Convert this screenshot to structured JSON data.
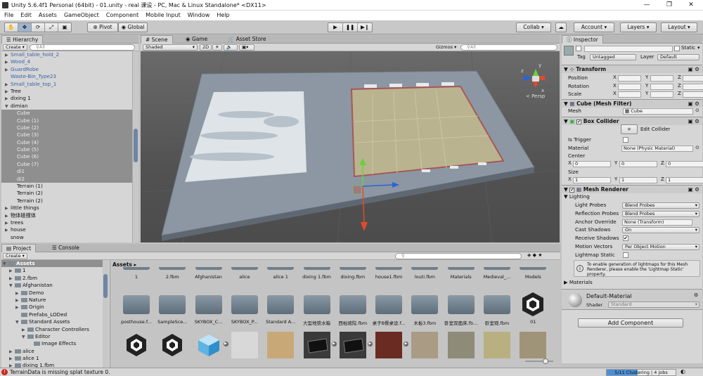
{
  "window": {
    "title": "Unity 5.6.4f1 Personal (64bit) - 01.unity - real 课设 - PC, Mac & Linux Standalone* <DX11>"
  },
  "menu": [
    "File",
    "Edit",
    "Assets",
    "GameObject",
    "Component",
    "Mobile Input",
    "Window",
    "Help"
  ],
  "toolbar": {
    "pivot": "Pivot",
    "global": "Global",
    "collab": "Collab ▾",
    "account": "Account",
    "layers": "Layers",
    "layout": "Layout"
  },
  "hierarchy": {
    "tab": "Hierarchy",
    "create": "Create ▾",
    "search": "All",
    "items": [
      {
        "label": "Small_table_hold_2",
        "indent": 1,
        "arrow": "▶",
        "style": "prefab"
      },
      {
        "label": "Wood_4",
        "indent": 1,
        "arrow": "▶",
        "style": "prefab"
      },
      {
        "label": "GuardRobe",
        "indent": 1,
        "arrow": "▶",
        "style": "prefab"
      },
      {
        "label": "Waste-Bin_Type23",
        "indent": 1,
        "arrow": "",
        "style": "prefab"
      },
      {
        "label": "Small_table_top_1",
        "indent": 1,
        "arrow": "▶",
        "style": "prefab"
      },
      {
        "label": "Tree",
        "indent": 1,
        "arrow": "▶",
        "style": "normal"
      },
      {
        "label": "dixing 1",
        "indent": 1,
        "arrow": "▶",
        "style": "normal"
      },
      {
        "label": "dimian",
        "indent": 1,
        "arrow": "▼",
        "style": "normal"
      },
      {
        "label": "Cube",
        "indent": 2,
        "arrow": "",
        "style": "selected"
      },
      {
        "label": "Cube (1)",
        "indent": 2,
        "arrow": "",
        "style": "selected"
      },
      {
        "label": "Cube (2)",
        "indent": 2,
        "arrow": "",
        "style": "selected"
      },
      {
        "label": "Cube (3)",
        "indent": 2,
        "arrow": "",
        "style": "selected"
      },
      {
        "label": "Cube (4)",
        "indent": 2,
        "arrow": "",
        "style": "selected"
      },
      {
        "label": "Cube (5)",
        "indent": 2,
        "arrow": "",
        "style": "selected"
      },
      {
        "label": "Cube (6)",
        "indent": 2,
        "arrow": "",
        "style": "selected"
      },
      {
        "label": "Cube (7)",
        "indent": 2,
        "arrow": "",
        "style": "selected"
      },
      {
        "label": "di1",
        "indent": 2,
        "arrow": "",
        "style": "selected"
      },
      {
        "label": "di2",
        "indent": 2,
        "arrow": "",
        "style": "selected"
      },
      {
        "label": "Terrain (1)",
        "indent": 2,
        "arrow": "",
        "style": "normal"
      },
      {
        "label": "Terrain (2)",
        "indent": 2,
        "arrow": "",
        "style": "normal"
      },
      {
        "label": "Terrain (2)",
        "indent": 2,
        "arrow": "",
        "style": "normal"
      },
      {
        "label": "little things",
        "indent": 1,
        "arrow": "▶",
        "style": "normal"
      },
      {
        "label": "物体碰撞体",
        "indent": 1,
        "arrow": "▶",
        "style": "normal"
      },
      {
        "label": "trees",
        "indent": 1,
        "arrow": "▶",
        "style": "normal"
      },
      {
        "label": "house",
        "indent": 1,
        "arrow": "▶",
        "style": "normal"
      },
      {
        "label": "snow",
        "indent": 1,
        "arrow": "",
        "style": "normal"
      }
    ]
  },
  "scene": {
    "tabs": [
      "Scene",
      "Game",
      "Asset Store"
    ],
    "shading": "Shaded",
    "mode2d": "2D",
    "gizmos": "Gizmos ▾",
    "search": "All",
    "persp": "< Persp",
    "axis": {
      "x": "x",
      "y": "y",
      "z": "z"
    }
  },
  "inspector": {
    "tab": "Inspector",
    "static": "Static",
    "tag_label": "Tag",
    "tag": "Untagged",
    "layer_label": "Layer",
    "layer": "Default",
    "transform": {
      "title": "Transform",
      "position": "Position",
      "rotation": "Rotation",
      "scale": "Scale",
      "x": "X",
      "y": "Y",
      "z": "Z"
    },
    "mesh_filter": {
      "title": "Cube (Mesh Filter)",
      "mesh_label": "Mesh",
      "mesh": "Cube"
    },
    "box_collider": {
      "title": "Box Collider",
      "edit": "Edit Collider",
      "is_trigger": "Is Trigger",
      "material_label": "Material",
      "material": "None (Physic Material)",
      "center": "Center",
      "size": "Size",
      "center_vals": {
        "x": "0",
        "y": "0",
        "z": "0"
      },
      "size_vals": {
        "x": "1",
        "y": "1",
        "z": "1"
      }
    },
    "mesh_renderer": {
      "title": "Mesh Renderer",
      "lighting": "Lighting",
      "rows": [
        {
          "label": "Light Probes",
          "value": "Blend Probes",
          "kind": "drop"
        },
        {
          "label": "Reflection Probes",
          "value": "Blend Probes",
          "kind": "drop"
        },
        {
          "label": "Anchor Override",
          "value": "None (Transform)",
          "kind": "field"
        },
        {
          "label": "Cast Shadows",
          "value": "On",
          "kind": "drop"
        },
        {
          "label": "Receive Shadows",
          "value": "✔",
          "kind": "check"
        },
        {
          "label": "Motion Vectors",
          "value": "Per Object Motion",
          "kind": "drop"
        },
        {
          "label": "Lightmap Static",
          "value": "",
          "kind": "check"
        }
      ],
      "info": "To enable generation of lightmaps for this Mesh Renderer, please enable the 'Lightmap Static' property."
    },
    "materials": "Materials",
    "material_name": "Default-Material",
    "shader_label": "Shader",
    "shader": "Standard",
    "add_component": "Add Component"
  },
  "project": {
    "tabs": [
      "Project",
      "Console"
    ],
    "create": "Create ▾",
    "breadcrumb": "Assets ▸",
    "tree": [
      {
        "label": "Assets",
        "indent": 0,
        "arrow": "▼",
        "sel": true
      },
      {
        "label": "1",
        "indent": 1,
        "arrow": "▶"
      },
      {
        "label": "2.fbm",
        "indent": 1,
        "arrow": "▶"
      },
      {
        "label": "Afghanistan",
        "indent": 1,
        "arrow": "▼"
      },
      {
        "label": "Demo",
        "indent": 2,
        "arrow": "▶"
      },
      {
        "label": "Nature",
        "indent": 2,
        "arrow": "▶"
      },
      {
        "label": "Origin",
        "indent": 2,
        "arrow": "▶"
      },
      {
        "label": "Prefabs_LODed",
        "indent": 2,
        "arrow": ""
      },
      {
        "label": "Standard Assets",
        "indent": 2,
        "arrow": "▼"
      },
      {
        "label": "Character Controllers",
        "indent": 3,
        "arrow": "▶"
      },
      {
        "label": "Editor",
        "indent": 3,
        "arrow": "▼"
      },
      {
        "label": "Image Effects",
        "indent": 4,
        "arrow": ""
      },
      {
        "label": "alice",
        "indent": 1,
        "arrow": "▶"
      },
      {
        "label": "alice 1",
        "indent": 1,
        "arrow": "▶"
      },
      {
        "label": "dixing 1.fbm",
        "indent": 1,
        "arrow": "▶"
      }
    ],
    "row1": [
      "1",
      "2.fbm",
      "Afghanistan",
      "alice",
      "alice 1",
      "dixing 1.fbm",
      "dixing.fbm",
      "house1.fbm",
      "louti.fbm",
      "Materials",
      "Medieval_...",
      "Models"
    ],
    "row2": [
      "posthouse.f...",
      "SampleSce...",
      "SKYBOX_C...",
      "SKYBOX_P...",
      "Standard A...",
      "大型地铁水箱",
      "西柏坡院.fbm",
      "桌子B餐桌设.f...",
      "木板3.fbm",
      "卧室双面床.fb...",
      "卧室观.fbm",
      "01"
    ]
  },
  "status": {
    "message": "TerrainData is missing splat texture 0.",
    "progress": "5/11 Clustering | 4 jobs",
    "progress_value": 0.45
  }
}
